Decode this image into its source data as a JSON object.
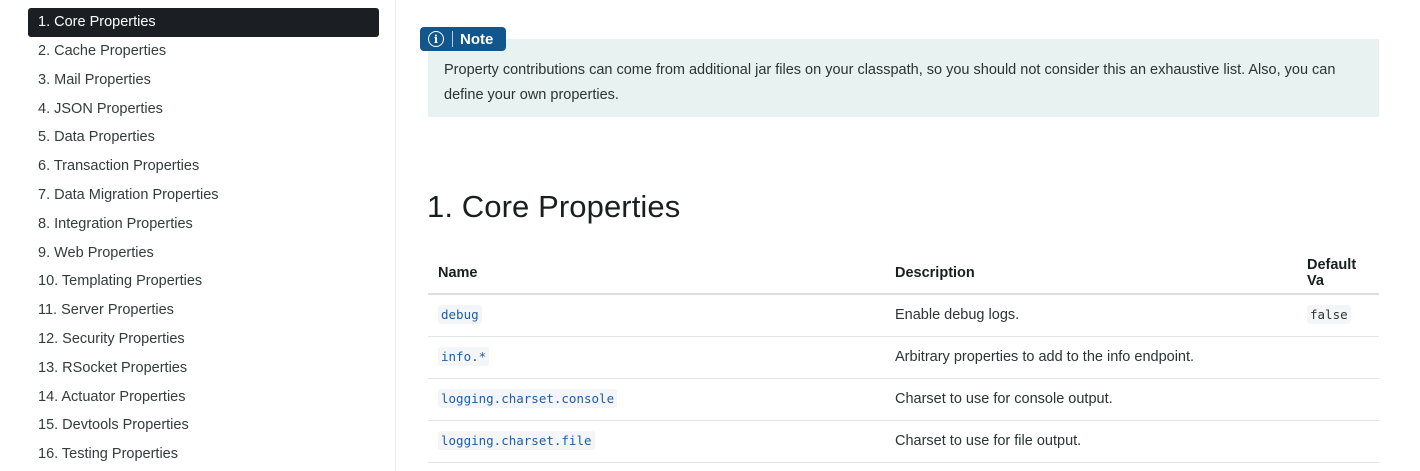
{
  "sidebar": {
    "items": [
      {
        "label": "1. Core Properties"
      },
      {
        "label": "2. Cache Properties"
      },
      {
        "label": "3. Mail Properties"
      },
      {
        "label": "4. JSON Properties"
      },
      {
        "label": "5. Data Properties"
      },
      {
        "label": "6. Transaction Properties"
      },
      {
        "label": "7. Data Migration Properties"
      },
      {
        "label": "8. Integration Properties"
      },
      {
        "label": "9. Web Properties"
      },
      {
        "label": "10. Templating Properties"
      },
      {
        "label": "11. Server Properties"
      },
      {
        "label": "12. Security Properties"
      },
      {
        "label": "13. RSocket Properties"
      },
      {
        "label": "14. Actuator Properties"
      },
      {
        "label": "15. Devtools Properties"
      },
      {
        "label": "16. Testing Properties"
      }
    ]
  },
  "note": {
    "badge": "Note",
    "icon_glyph": "i",
    "text": "Property contributions can come from additional jar files on your classpath, so you should not consider this an exhaustive list. Also, you can define your own properties."
  },
  "section": {
    "title": "1. Core Properties"
  },
  "table": {
    "headers": {
      "name": "Name",
      "description": "Description",
      "default": "Default Va"
    },
    "rows": [
      {
        "name": "debug",
        "description": "Enable debug logs.",
        "default": "false"
      },
      {
        "name": "info.*",
        "description": "Arbitrary properties to add to the info endpoint.",
        "default": ""
      },
      {
        "name": "logging.charset.console",
        "description": "Charset to use for console output.",
        "default": ""
      },
      {
        "name": "logging.charset.file",
        "description": "Charset to use for file output.",
        "default": ""
      }
    ]
  },
  "colors": {
    "active_item_bg": "#1b1f23",
    "note_badge_bg": "#11568d",
    "note_box_bg": "#e8f2f0",
    "code_text": "#1f5ea8"
  }
}
